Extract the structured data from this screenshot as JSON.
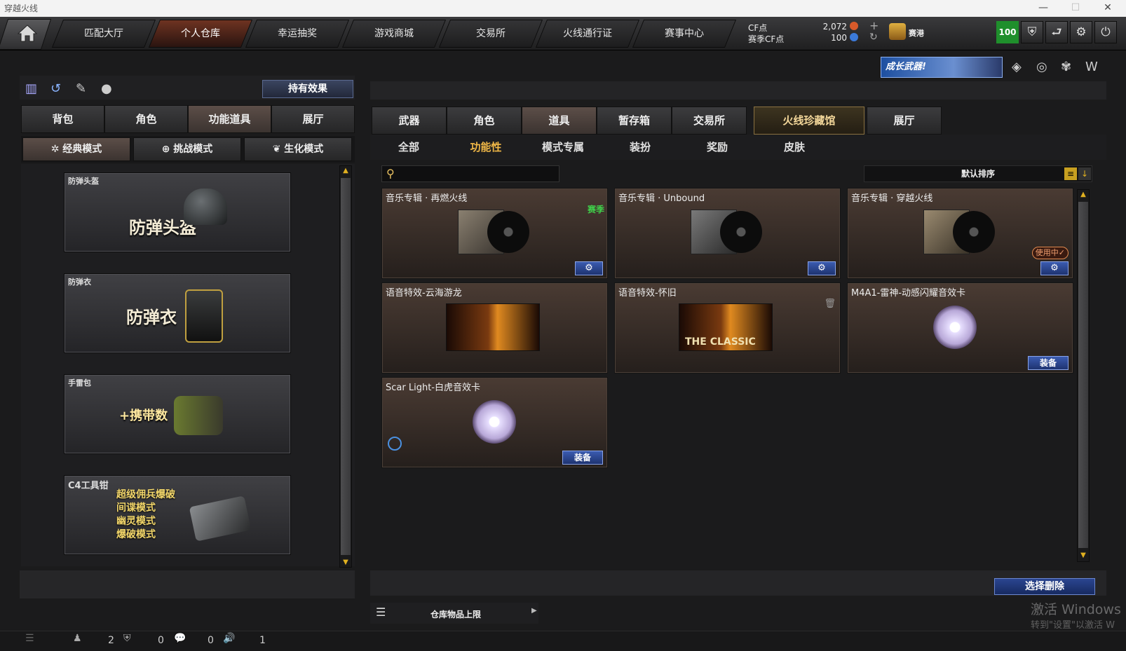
{
  "window": {
    "title": "穿越火线",
    "min": "—",
    "max": "☐",
    "close": "✕"
  },
  "nav": {
    "tabs": [
      "匹配大厅",
      "个人仓库",
      "幸运抽奖",
      "游戏商城",
      "交易所",
      "火线通行证",
      "赛事中心"
    ]
  },
  "currency": {
    "cf_label": "CF点",
    "cf_value": "2,072",
    "season_label": "赛季CF点",
    "season_value": "100",
    "plus": "+",
    "refresh": "↻"
  },
  "rank": {
    "name": "赛港"
  },
  "level_badge": "100",
  "growth_banner": "成长武器!",
  "left": {
    "effects_button": "持有效果",
    "tabs": [
      "背包",
      "角色",
      "功能道具",
      "展厅"
    ],
    "modes": [
      "经典模式",
      "挑战模式",
      "生化模式"
    ],
    "cards": [
      {
        "label": "防弹头盔",
        "big": "防弹头盔"
      },
      {
        "label": "防弹衣",
        "big": "防弹衣"
      },
      {
        "label": "手雷包",
        "big": "+携带数"
      },
      {
        "label": "C4工具钳",
        "lines": [
          "超级佣兵爆破",
          "间谍模式",
          "幽灵模式",
          "爆破模式"
        ]
      }
    ]
  },
  "right": {
    "tabs": [
      "武器",
      "角色",
      "道具",
      "暂存箱",
      "交易所",
      "火线珍藏馆",
      "展厅"
    ],
    "subtabs": [
      "全部",
      "功能性",
      "模式专属",
      "装扮",
      "奖励",
      "皮肤"
    ],
    "search_placeholder": "",
    "sort_label": "默认排序",
    "items": [
      {
        "label": "音乐专辑 · 再燃火线",
        "tag": "赛季",
        "button": "⚙"
      },
      {
        "label": "音乐专辑 · Unbound",
        "button": "⚙"
      },
      {
        "label": "音乐专辑 · 穿越火线",
        "inuse": "使用中✓",
        "button": "⚙"
      },
      {
        "label": "语音特效-云海游龙"
      },
      {
        "label": "语音特效-怀旧",
        "art_text": "THE CLASSIC"
      },
      {
        "label": "M4A1-雷神-动感闪耀音效卡",
        "button": "装备"
      },
      {
        "label": "Scar Light-白虎音效卡",
        "button": "装备"
      }
    ],
    "delete_button": "选择删除",
    "storage_label": "仓库物品上限"
  },
  "statusbar": {
    "counts": [
      "2",
      "0",
      "0",
      "1"
    ]
  },
  "watermark": {
    "line1": "激活 Windows",
    "line2": "转到\"设置\"以激活 W"
  },
  "colors": {
    "active_tab": "#6e3321",
    "subtab_active": "#f1b847",
    "green": "#1f8f2c",
    "button_blue": "#2a4590"
  }
}
